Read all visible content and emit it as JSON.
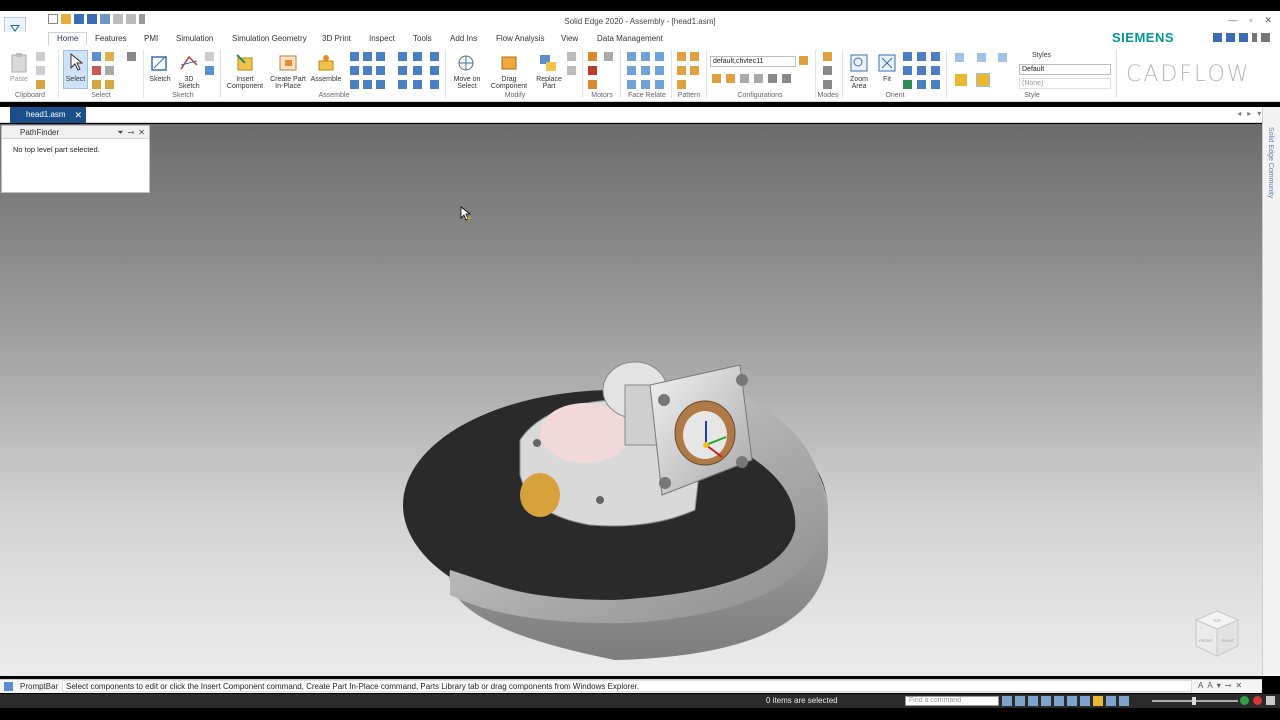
{
  "window": {
    "title": "Solid Edge 2020 - Assembly - [head1.asm]",
    "controls": [
      "—",
      "▫",
      "✕"
    ]
  },
  "tabs": [
    {
      "label": "Home",
      "active": true
    },
    {
      "label": "Features"
    },
    {
      "label": "PMI"
    },
    {
      "label": "Simulation"
    },
    {
      "label": "Simulation Geometry"
    },
    {
      "label": "3D Print"
    },
    {
      "label": "Inspect"
    },
    {
      "label": "Tools"
    },
    {
      "label": "Add Ins"
    },
    {
      "label": "Flow Analysis"
    },
    {
      "label": "View"
    },
    {
      "label": "Data Management"
    }
  ],
  "brand": "SIEMENS",
  "watermark": "CADFLOW",
  "ribbon": {
    "clipboard": {
      "paste": "Paste",
      "group": "Clipboard"
    },
    "select": {
      "select": "Select",
      "group": "Select"
    },
    "sketch": {
      "sketch": "Sketch",
      "sketch3d_l1": "3D",
      "sketch3d_l2": "Sketch",
      "group": "Sketch"
    },
    "assemble": {
      "insert_l1": "Insert",
      "insert_l2": "Component",
      "create_l1": "Create Part",
      "create_l2": "In-Place",
      "assemble": "Assemble",
      "group": "Assemble"
    },
    "modify": {
      "move_l1": "Move on",
      "move_l2": "Select",
      "drag_l1": "Drag",
      "drag_l2": "Component",
      "replace_l1": "Replace",
      "replace_l2": "Part",
      "group": "Modify"
    },
    "motors": {
      "group": "Motors"
    },
    "face_relate": {
      "group": "Face Relate"
    },
    "pattern": {
      "group": "Pattern"
    },
    "configurations": {
      "value": "default,chvtec11",
      "group": "Configurations"
    },
    "modes": {
      "group": "Modes"
    },
    "orient": {
      "zoom_l1": "Zoom",
      "zoom_l2": "Area",
      "fit": "Fit",
      "group": "Orient"
    },
    "style": {
      "styles_label": "Styles",
      "style_value": "Default",
      "none_value": "(None)",
      "group": "Style"
    }
  },
  "document": {
    "tab_label": "head1.asm",
    "close": "✕"
  },
  "right_panel_label": "Solid Edge Community",
  "pathfinder": {
    "title": "PathFinder",
    "message": "No top level part selected."
  },
  "prompt_bar": {
    "label": "PromptBar",
    "message": "Select components to edit or click the Insert Component command, Create Part In-Place command, Parts Library tab or drag components from Windows Explorer."
  },
  "status": {
    "selection": "0 items are selected",
    "find_placeholder": "Find a command"
  },
  "viewcube": {
    "top": "TOP",
    "front": "FRONT",
    "right": "RIGHT"
  },
  "colors": {
    "accent": "#1c4f8a",
    "siemens": "#009999",
    "select_highlight": "#cfe3f7"
  }
}
